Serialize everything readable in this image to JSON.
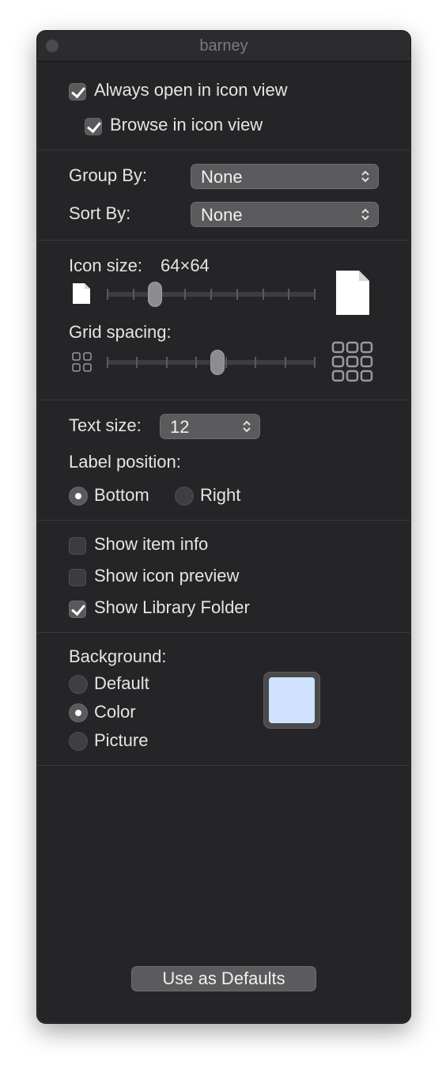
{
  "window": {
    "title": "barney"
  },
  "options": {
    "always_open_label": "Always open in icon view",
    "always_open_checked": true,
    "browse_label": "Browse in icon view",
    "browse_checked": true
  },
  "arrange": {
    "group_by_label": "Group By:",
    "group_by_value": "None",
    "sort_by_label": "Sort By:",
    "sort_by_value": "None"
  },
  "icon_size": {
    "label": "Icon size:",
    "value": "64×64",
    "slider_fraction": 0.23
  },
  "grid_spacing": {
    "label": "Grid spacing:",
    "slider_fraction": 0.53
  },
  "text_size": {
    "label": "Text size:",
    "value": "12"
  },
  "label_position": {
    "label": "Label position:",
    "options": [
      "Bottom",
      "Right"
    ],
    "selected": "Bottom"
  },
  "show": {
    "item_info_label": "Show item info",
    "item_info_checked": false,
    "icon_preview_label": "Show icon preview",
    "icon_preview_checked": false,
    "library_label": "Show Library Folder",
    "library_checked": true
  },
  "background": {
    "label": "Background:",
    "options": [
      "Default",
      "Color",
      "Picture"
    ],
    "selected": "Color",
    "color": "#cfe2ff"
  },
  "footer": {
    "use_defaults_label": "Use as Defaults"
  }
}
